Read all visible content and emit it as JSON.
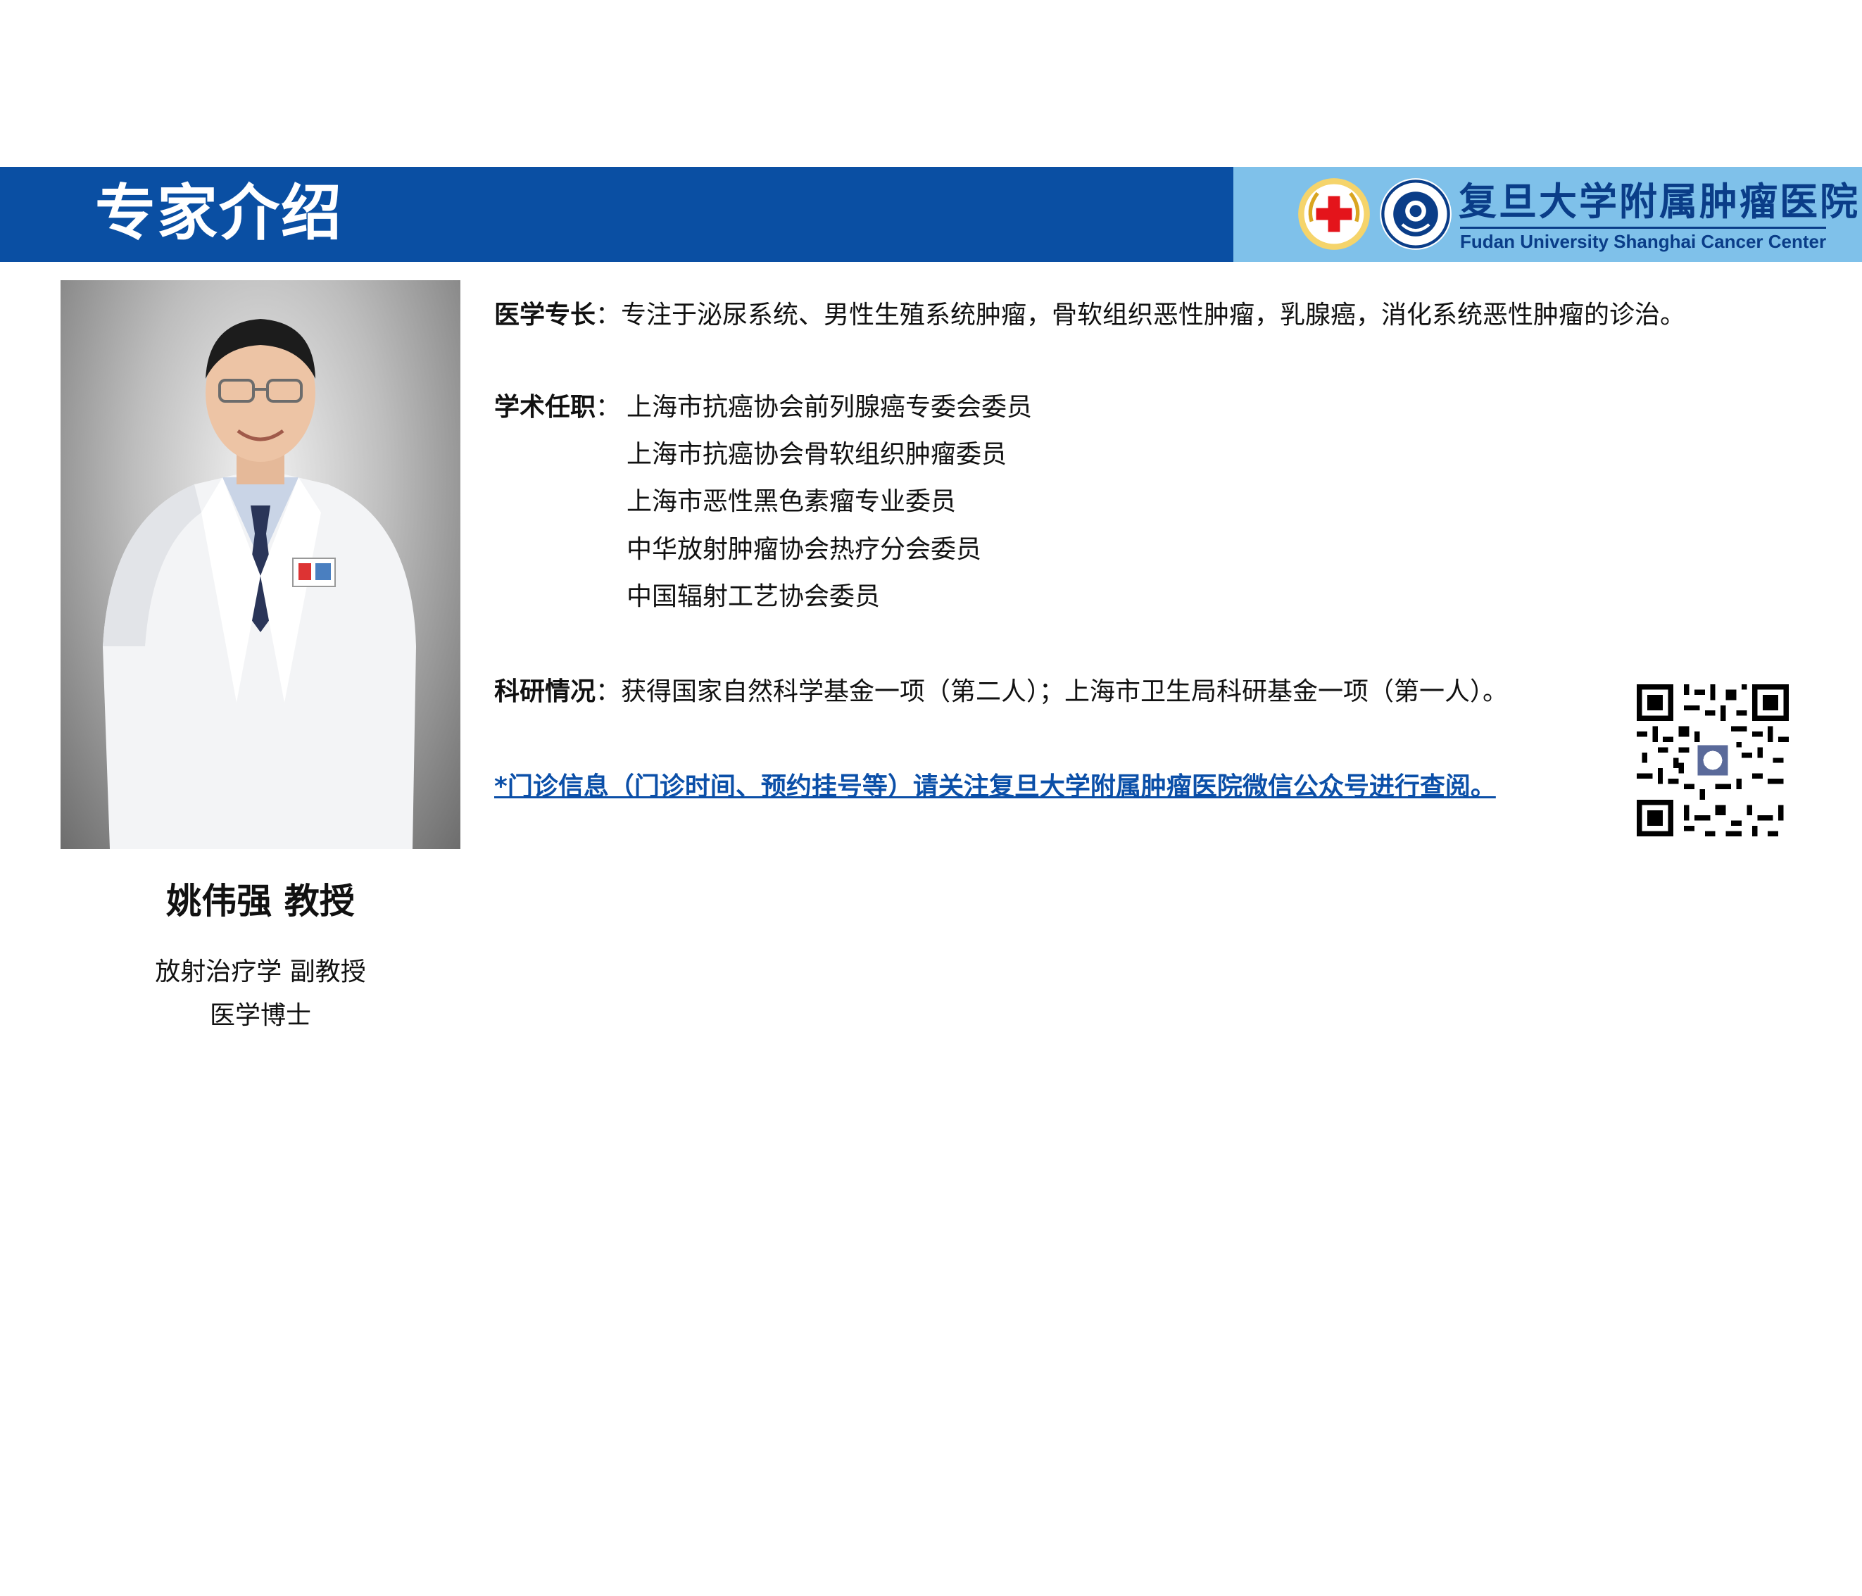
{
  "header": {
    "title": "专家介绍",
    "hospital_name_cn": "复旦大学附属肿瘤医院",
    "hospital_name_en": "Fudan University Shanghai Cancer Center"
  },
  "profile": {
    "name": "姚伟强 教授",
    "title_line1": "放射治疗学 副教授",
    "title_line2": "医学博士"
  },
  "specialty": {
    "label": "医学专长",
    "separator": "：",
    "text": "专注于泌尿系统、男性生殖系统肿瘤，骨软组织恶性肿瘤，乳腺癌，消化系统恶性肿瘤的诊治。"
  },
  "positions": {
    "label": "学术任职",
    "separator": "：",
    "items": [
      "上海市抗癌协会前列腺癌专委会委员",
      "上海市抗癌协会骨软组织肿瘤委员",
      "上海市恶性黑色素瘤专业委员",
      "中华放射肿瘤协会热疗分会委员",
      "中国辐射工艺协会委员"
    ]
  },
  "research": {
    "label": "科研情况",
    "separator": "：",
    "text": "获得国家自然科学基金一项（第二人）；上海市卫生局科研基金一项（第一人）。"
  },
  "notice": {
    "text": "*门诊信息（门诊时间、预约挂号等）请关注复旦大学附属肿瘤医院微信公众号进行查阅。"
  },
  "colors": {
    "banner_blue": "#0a4fa3",
    "banner_light": "#7fc1ea",
    "notice_blue": "#0b4fa8"
  }
}
